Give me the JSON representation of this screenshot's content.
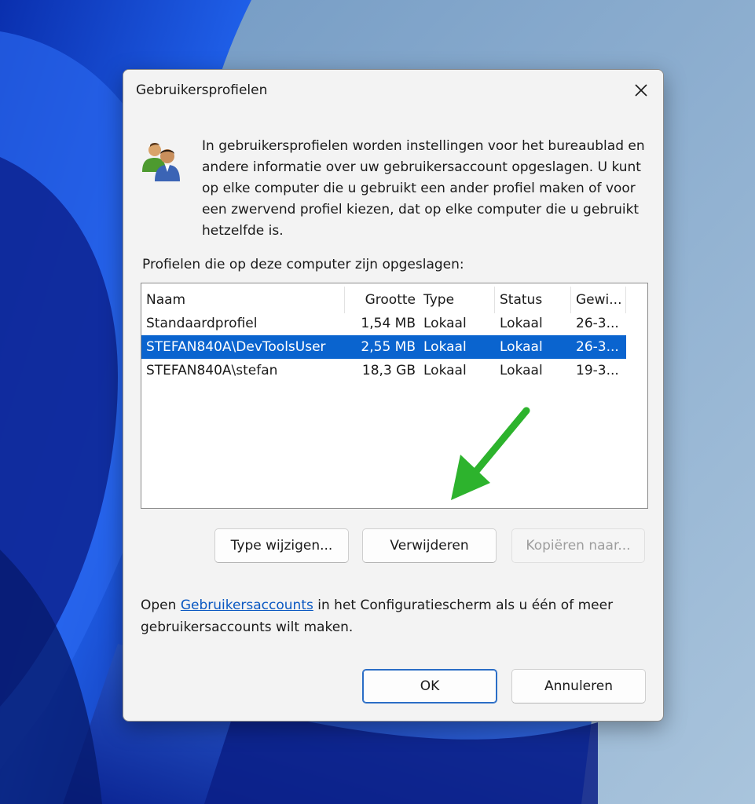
{
  "dialog": {
    "title": "Gebruikersprofielen",
    "intro": "In gebruikersprofielen worden instellingen voor het bureaublad en andere informatie over uw gebruikersaccount opgeslagen. U kunt op elke computer die u gebruikt een ander profiel maken of voor een zwervend profiel kiezen, dat op elke computer die u gebruikt hetzelfde is.",
    "list_label": "Profielen die op deze computer zijn opgeslagen:",
    "columns": [
      "Naam",
      "Grootte",
      "Type",
      "Status",
      "Gewi..."
    ],
    "profiles": [
      {
        "name": "Standaardprofiel",
        "size": "1,54 MB",
        "type": "Lokaal",
        "status": "Lokaal",
        "modified": "26-3...",
        "selected": false
      },
      {
        "name": "STEFAN840A\\DevToolsUser",
        "size": "2,55 MB",
        "type": "Lokaal",
        "status": "Lokaal",
        "modified": "26-3...",
        "selected": true
      },
      {
        "name": "STEFAN840A\\stefan",
        "size": "18,3 GB",
        "type": "Lokaal",
        "status": "Lokaal",
        "modified": "19-3...",
        "selected": false
      }
    ],
    "buttons": {
      "change_type": "Type wijzigen...",
      "delete": "Verwijderen",
      "copy_to": "Kopiëren naar...",
      "ok": "OK",
      "cancel": "Annuleren"
    },
    "footer": {
      "prefix": "Open ",
      "link": "Gebruikersaccounts",
      "suffix": " in het Configuratiescherm als u één of meer gebruikersaccounts wilt maken."
    }
  },
  "icons": {
    "close": "close-icon",
    "users": "users-icon",
    "annotation_arrow": "arrow-icon"
  },
  "colors": {
    "selection": "#0a64cf",
    "link": "#0a58c2",
    "arrow": "#2db32d",
    "default_button_border": "#2a6dc6"
  }
}
